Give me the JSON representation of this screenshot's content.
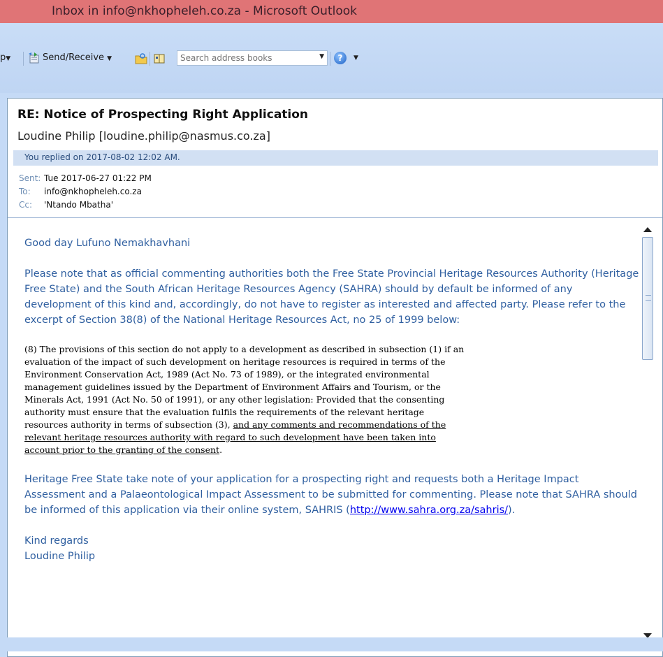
{
  "window": {
    "title": "Inbox in info@nkhopheleh.co.za - Microsoft Outlook"
  },
  "toolbar": {
    "group_partial_label": "p",
    "send_receive_label": "Send/Receive",
    "search_placeholder": "Search address books",
    "help_icon_glyph": "?"
  },
  "message": {
    "subject": "RE: Notice of Prospecting Right Application",
    "from": "Loudine Philip [loudine.philip@nasmus.co.za]",
    "info_bar": "You replied on 2017-08-02 12:02 AM.",
    "sent_label": "Sent:",
    "sent_value": "Tue 2017-06-27 01:22 PM",
    "to_label": "To:",
    "to_value": "info@nkhopheleh.co.za",
    "cc_label": "Cc:",
    "cc_value": "'Ntando Mbatha'"
  },
  "body": {
    "greeting": "Good day Lufuno Nemakhavhani",
    "para1": "Please note that as official commenting authorities both the Free State Provincial Heritage Resources Authority (Heritage Free State) and the South African Heritage Resources Agency (SAHRA) should by default be informed of any development of this kind and, accordingly, do not have to register as interested and affected party.  Please refer to the excerpt of Section 38(8) of the National Heritage Resources Act, no 25 of 1999 below:",
    "quote_plain": "(8) The provisions of this section do not apply to a development as described in subsection (1) if an evaluation of the impact of such development on heritage resources is required in terms of the Environment Conservation Act, 1989 (Act No. 73 of 1989), or the integrated environmental management guidelines issued by the Department of Environment Affairs and Tourism, or the Minerals Act, 1991 (Act No. 50 of 1991), or any other legislation: Provided that the consenting authority must ensure that the evaluation fulfils the requirements of the relevant heritage resources authority in terms of subsection (3),",
    "quote_underlined": "and any comments and recommendations of the relevant heritage resources authority with regard to such development have been taken into account prior to the granting of the consent",
    "quote_end": ".",
    "para2_start": "Heritage Free State take note of your application for a prospecting right and requests both a Heritage Impact Assessment and a Palaeontological Impact Assessment to be submitted for commenting.  Please note that SAHRA should be informed of this application via their online system, SAHRIS (",
    "para2_link": "http://www.sahra.org.za/sahris/",
    "para2_end": ").",
    "closing": "Kind regards",
    "signature": "Loudine Philip"
  },
  "colors": {
    "titlebar": "#e07476",
    "chrome": "#c5daf6",
    "body_text": "#2f5fa0",
    "info_bar": "#d2e0f3"
  }
}
